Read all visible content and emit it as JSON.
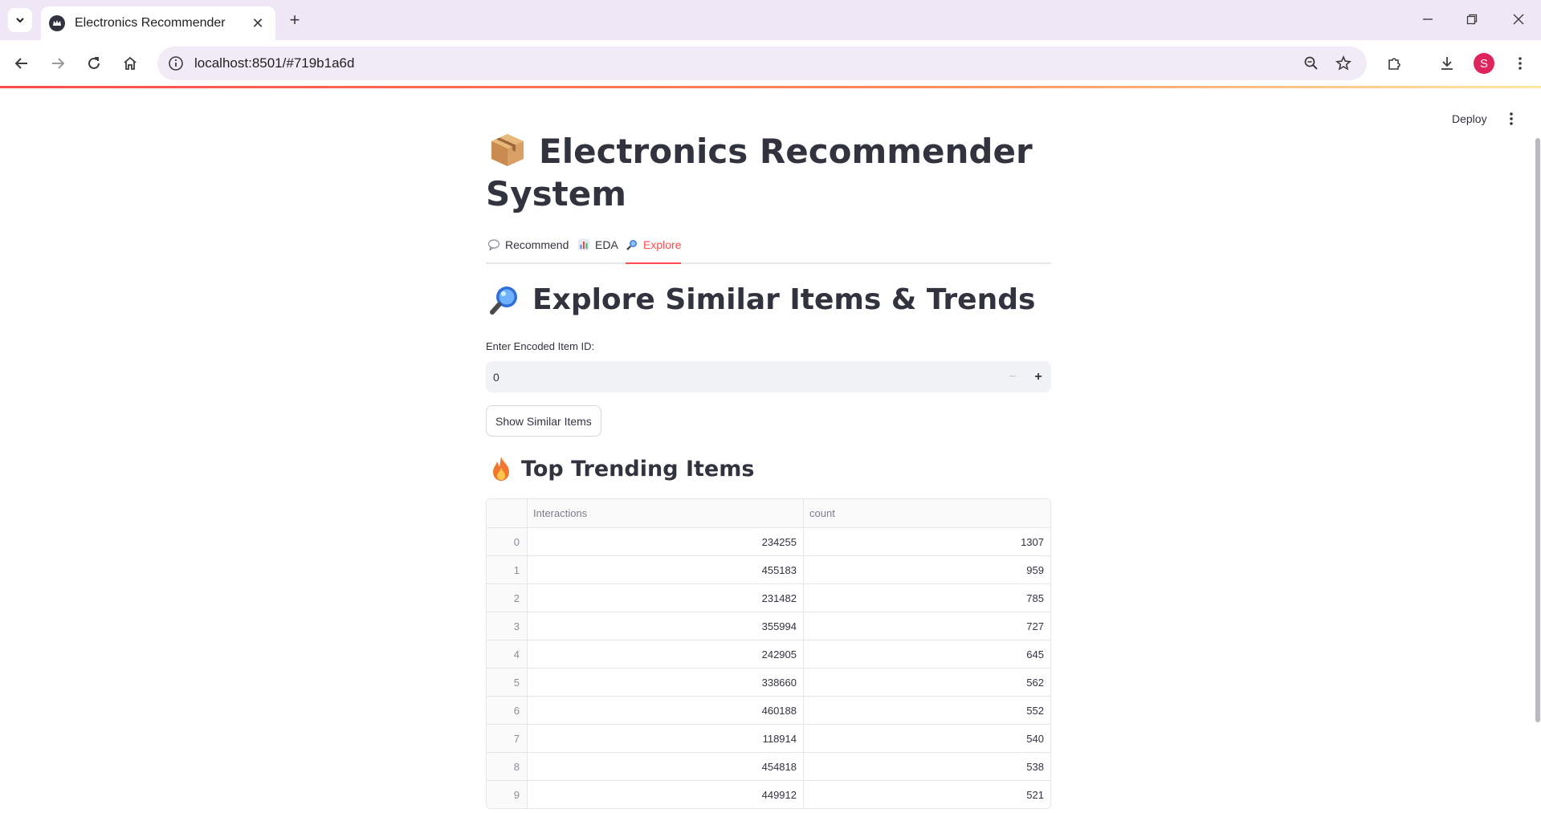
{
  "browser": {
    "tab_title": "Electronics Recommender",
    "url": "localhost:8501/#719b1a6d",
    "profile_initial": "S"
  },
  "app": {
    "deploy_label": "Deploy",
    "title": "Electronics Recommender System",
    "tabs": [
      {
        "label": "Recommend",
        "active": false
      },
      {
        "label": "EDA",
        "active": false
      },
      {
        "label": "Explore",
        "active": true
      }
    ],
    "section_title": "Explore Similar Items & Trends",
    "input_label": "Enter Encoded Item ID:",
    "input_value": "0",
    "button_label": "Show Similar Items",
    "trending_title": "Top Trending Items",
    "table": {
      "columns": [
        "Interactions",
        "count"
      ],
      "rows": [
        {
          "index": "0",
          "Interactions": "234255",
          "count": "1307"
        },
        {
          "index": "1",
          "Interactions": "455183",
          "count": "959"
        },
        {
          "index": "2",
          "Interactions": "231482",
          "count": "785"
        },
        {
          "index": "3",
          "Interactions": "355994",
          "count": "727"
        },
        {
          "index": "4",
          "Interactions": "242905",
          "count": "645"
        },
        {
          "index": "5",
          "Interactions": "338660",
          "count": "562"
        },
        {
          "index": "6",
          "Interactions": "460188",
          "count": "552"
        },
        {
          "index": "7",
          "Interactions": "118914",
          "count": "540"
        },
        {
          "index": "8",
          "Interactions": "454818",
          "count": "538"
        },
        {
          "index": "9",
          "Interactions": "449912",
          "count": "521"
        }
      ]
    }
  },
  "colors": {
    "accent": "#ff4b4b",
    "text": "#31333f",
    "input_bg": "#f0f2f6"
  }
}
